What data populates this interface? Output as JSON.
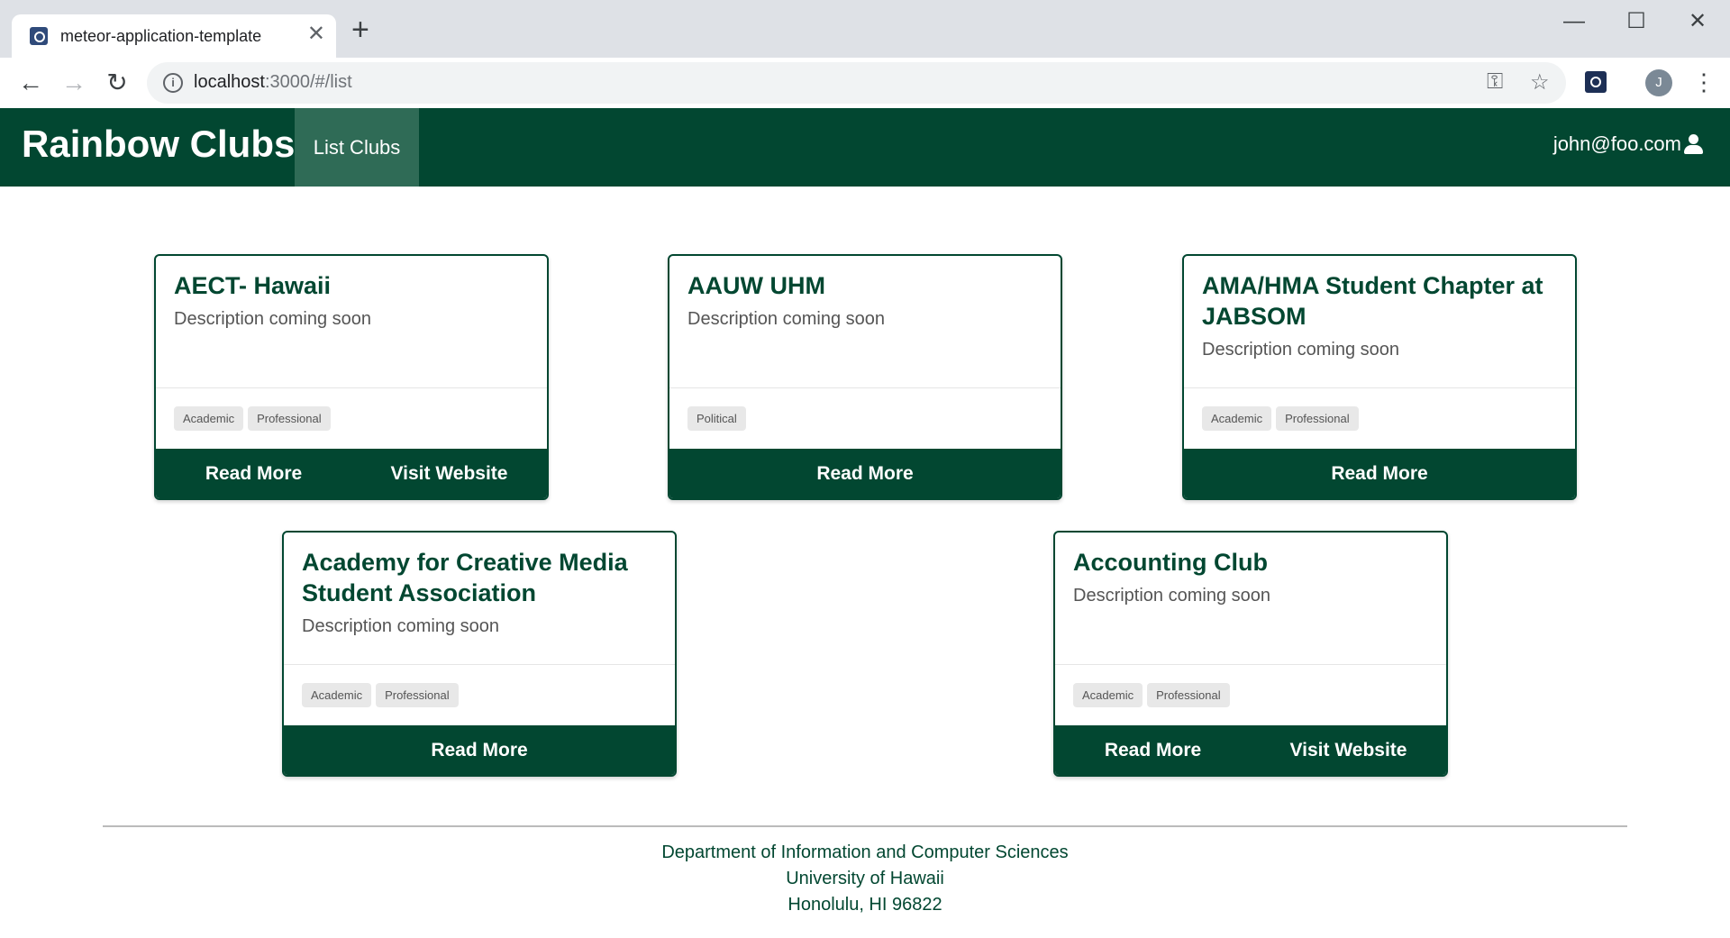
{
  "browser": {
    "tab_title": "meteor-application-template",
    "tab_close": "✕",
    "new_tab": "+",
    "url_host": "localhost",
    "url_rest": ":3000/#/list",
    "profile_initial": "J"
  },
  "navbar": {
    "brand": "Rainbow Clubs",
    "link": "List Clubs",
    "user": "john@foo.com"
  },
  "cards": [
    {
      "title": "AECT- Hawaii",
      "description": "Description coming soon",
      "tags": [
        "Academic",
        "Professional"
      ],
      "buttons": [
        "Read More",
        "Visit Website"
      ]
    },
    {
      "title": "AAUW UHM",
      "description": "Description coming soon",
      "tags": [
        "Political"
      ],
      "buttons": [
        "Read More"
      ]
    },
    {
      "title": "AMA/HMA Student Chapter at JABSOM",
      "description": "Description coming soon",
      "tags": [
        "Academic",
        "Professional"
      ],
      "buttons": [
        "Read More"
      ]
    },
    {
      "title": "Academy for Creative Media Student Association",
      "description": "Description coming soon",
      "tags": [
        "Academic",
        "Professional"
      ],
      "buttons": [
        "Read More"
      ]
    },
    {
      "title": "Accounting Club",
      "description": "Description coming soon",
      "tags": [
        "Academic",
        "Professional"
      ],
      "buttons": [
        "Read More",
        "Visit Website"
      ]
    }
  ],
  "footer": {
    "line1": "Department of Information and Computer Sciences",
    "line2": "University of Hawaii",
    "line3": "Honolulu, HI 96822"
  },
  "colors": {
    "brand_green": "#024731",
    "active_link": "#2f6b56"
  }
}
